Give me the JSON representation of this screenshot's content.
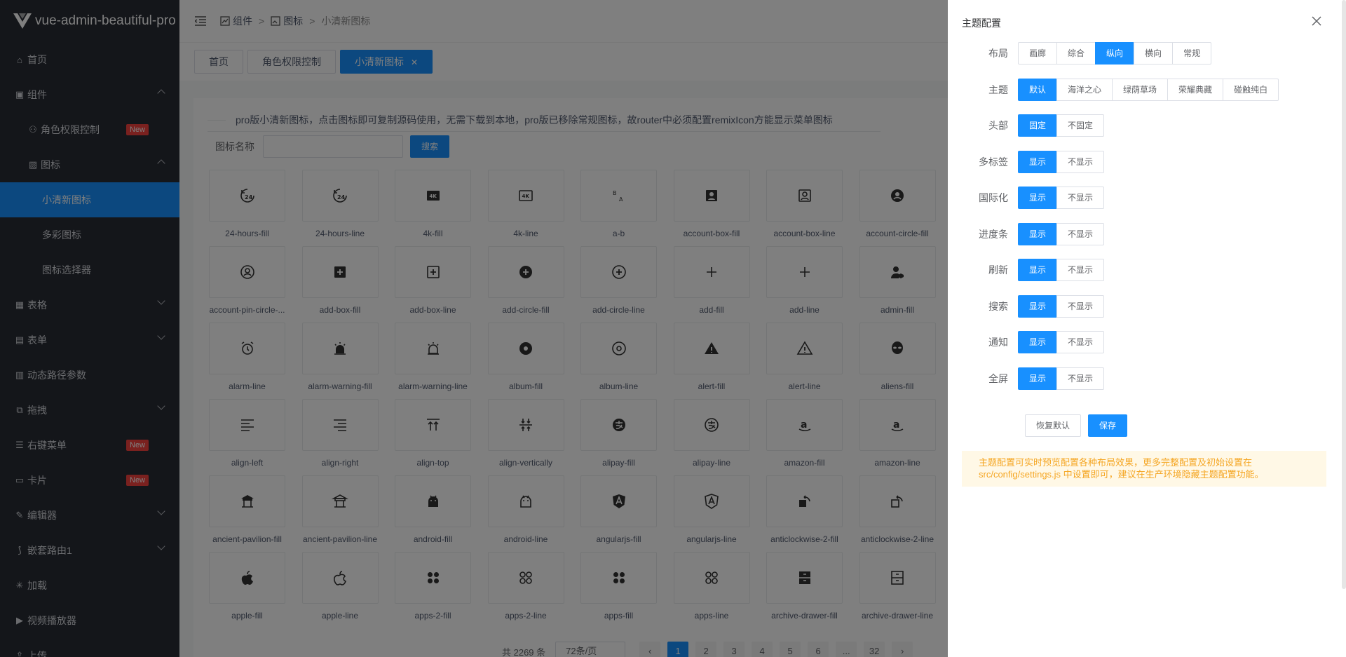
{
  "app": {
    "title": "vue-admin-beautiful-pro"
  },
  "sidebar": {
    "items": [
      {
        "label": "首页",
        "icon": "home-icon"
      },
      {
        "label": "组件",
        "icon": "dashboard-icon"
      },
      {
        "label": "角色权限控制",
        "icon": "user-icon",
        "badge": "New"
      },
      {
        "label": "图标",
        "icon": "image-icon"
      },
      {
        "label": "小清新图标"
      },
      {
        "label": "多彩图标"
      },
      {
        "label": "图标选择器"
      },
      {
        "label": "表格",
        "icon": "table-icon"
      },
      {
        "label": "表单",
        "icon": "file-icon"
      },
      {
        "label": "动态路径参数",
        "icon": "file-list-icon"
      },
      {
        "label": "拖拽",
        "icon": "drag-icon"
      },
      {
        "label": "右键菜单",
        "icon": "menu-icon",
        "badge": "New"
      },
      {
        "label": "卡片",
        "icon": "inbox-icon",
        "badge": "New"
      },
      {
        "label": "编辑器",
        "icon": "edit-icon"
      },
      {
        "label": "嵌套路由1",
        "icon": "route-icon"
      },
      {
        "label": "加载",
        "icon": "loader-icon"
      },
      {
        "label": "视频播放器",
        "icon": "video-icon"
      },
      {
        "label": "上传",
        "icon": "upload-icon"
      }
    ]
  },
  "breadcrumb": {
    "items": [
      "组件",
      "图标",
      "小清新图标"
    ]
  },
  "tabs": [
    {
      "label": "首页"
    },
    {
      "label": "角色权限控制"
    },
    {
      "label": "小清新图标"
    }
  ],
  "notice": "pro版小清新图标，点击图标即可复制源码使用，无需下载到本地，pro版已移除常规图标，故router中必须配置remixIcon方能显示菜单图标",
  "search": {
    "label": "图标名称",
    "button": "搜索"
  },
  "icons": [
    "24-hours-fill",
    "24-hours-line",
    "4k-fill",
    "4k-line",
    "a-b",
    "account-box-fill",
    "account-box-line",
    "account-circle-fill",
    "account-pin-circle-...",
    "add-box-fill",
    "add-box-line",
    "add-circle-fill",
    "add-circle-line",
    "add-fill",
    "add-line",
    "admin-fill",
    "alarm-line",
    "alarm-warning-fill",
    "alarm-warning-line",
    "album-fill",
    "album-line",
    "alert-fill",
    "alert-line",
    "aliens-fill",
    "align-left",
    "align-right",
    "align-top",
    "align-vertically",
    "alipay-fill",
    "alipay-line",
    "amazon-fill",
    "amazon-line",
    "ancient-pavilion-fill",
    "ancient-pavilion-line",
    "android-fill",
    "android-line",
    "angularjs-fill",
    "angularjs-line",
    "anticlockwise-2-fill",
    "anticlockwise-2-line",
    "apple-fill",
    "apple-line",
    "apps-2-fill",
    "apps-2-line",
    "apps-fill",
    "apps-line",
    "archive-drawer-fill",
    "archive-drawer-line"
  ],
  "pagination": {
    "total": "共 2269 条",
    "size": "72条/页",
    "pages": [
      "1",
      "2",
      "3",
      "4",
      "5",
      "6",
      "...",
      "32"
    ],
    "current": "1"
  },
  "drawer": {
    "title": "主题配置",
    "rows": [
      {
        "label": "布局",
        "options": [
          "画廊",
          "综合",
          "纵向",
          "横向",
          "常规"
        ],
        "selected": 2
      },
      {
        "label": "主题",
        "options": [
          "默认",
          "海洋之心",
          "绿荫草场",
          "荣耀典藏",
          "碰触纯白"
        ],
        "selected": 0
      },
      {
        "label": "头部",
        "options": [
          "固定",
          "不固定"
        ],
        "selected": 0
      },
      {
        "label": "多标签",
        "options": [
          "显示",
          "不显示"
        ],
        "selected": 0
      },
      {
        "label": "国际化",
        "options": [
          "显示",
          "不显示"
        ],
        "selected": 0
      },
      {
        "label": "进度条",
        "options": [
          "显示",
          "不显示"
        ],
        "selected": 0
      },
      {
        "label": "刷新",
        "options": [
          "显示",
          "不显示"
        ],
        "selected": 0
      },
      {
        "label": "搜索",
        "options": [
          "显示",
          "不显示"
        ],
        "selected": 0
      },
      {
        "label": "通知",
        "options": [
          "显示",
          "不显示"
        ],
        "selected": 0
      },
      {
        "label": "全屏",
        "options": [
          "显示",
          "不显示"
        ],
        "selected": 0
      }
    ],
    "reset_label": "恢复默认",
    "save_label": "保存",
    "alert_line1": "主题配置可实时预览配置各种布局效果，更多完整配置及初始设置在",
    "alert_line2": "src/config/settings.js 中设置即可，建议在生产环境隐藏主题配置功能。"
  },
  "colors": {
    "primary": "#1890ff",
    "sidebar": "#282c34",
    "badge": "#f5433f",
    "alert_text": "#f5a623"
  }
}
